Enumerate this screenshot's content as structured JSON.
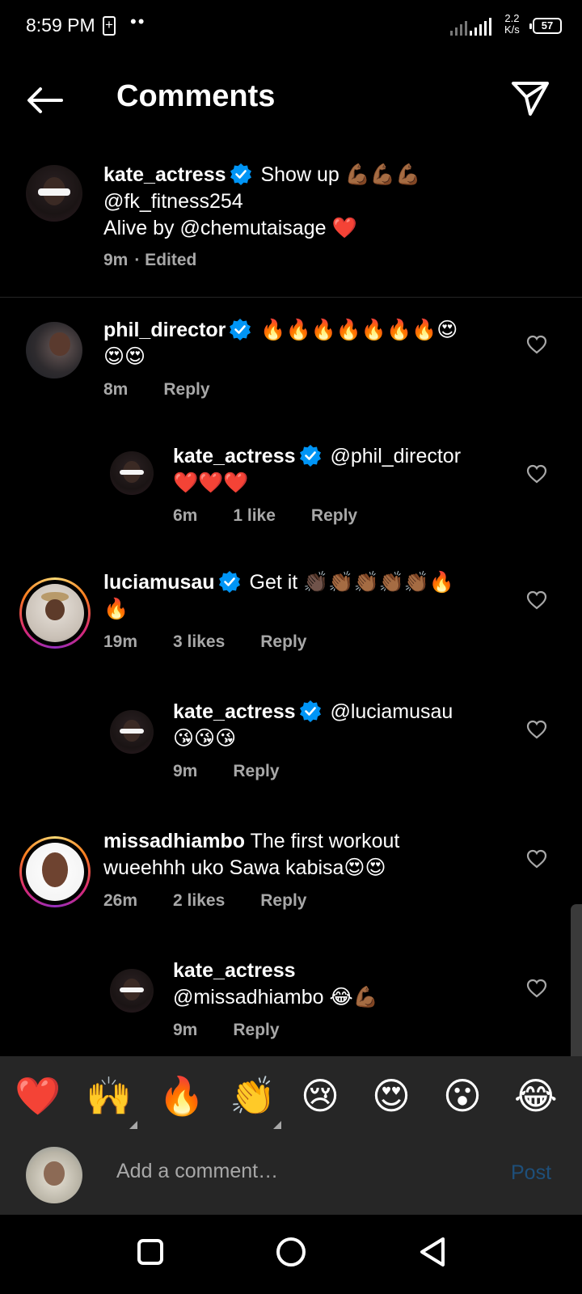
{
  "status_bar": {
    "time": "8:59 PM",
    "dots": "••",
    "speed_value": "2.2",
    "speed_unit": "K/s",
    "battery": "57"
  },
  "header": {
    "title": "Comments",
    "back_icon": "back-arrow-icon",
    "share_icon": "paper-plane-icon"
  },
  "caption": {
    "username": "kate_actress",
    "line1": "Show up 💪🏾💪🏾💪🏾",
    "line2": "@fk_fitness254",
    "line3": "Alive by @chemutaisage ❤️",
    "time": "9m",
    "edited": "· Edited"
  },
  "comments": [
    {
      "username": "phil_director",
      "text": "🔥🔥🔥🔥🔥🔥🔥😍",
      "text2": "😍😍",
      "time": "8m",
      "likes": "",
      "reply": "Reply"
    },
    {
      "username": "kate_actress",
      "text": "@phil_director",
      "text2": "❤️❤️❤️",
      "time": "6m",
      "likes": "1 like",
      "reply": "Reply"
    },
    {
      "username": "luciamusau",
      "text": "Get it 👏🏿👏🏾👏🏾👏🏾👏🏾🔥",
      "text2": "🔥",
      "time": "19m",
      "likes": "3 likes",
      "reply": "Reply"
    },
    {
      "username": "kate_actress",
      "text": "@luciamusau",
      "text2": "😘😘😘",
      "time": "9m",
      "likes": "",
      "reply": "Reply"
    },
    {
      "username": "missadhiambo",
      "text": "The first workout",
      "text2": "wueehhh uko Sawa kabisa😍😍",
      "time": "26m",
      "likes": "2 likes",
      "reply": "Reply"
    },
    {
      "username": "kate_actress",
      "text": "",
      "text2": "@missadhiambo 😂💪🏾",
      "time": "9m",
      "likes": "",
      "reply": "Reply"
    }
  ],
  "emoji_bar": [
    "❤️",
    "🙌",
    "🔥",
    "👏",
    "😢",
    "😍",
    "😮",
    "😂"
  ],
  "composer": {
    "placeholder": "Add a comment…",
    "post": "Post"
  },
  "colors": {
    "verified": "#0095f6",
    "secondary_text": "#a8a8a8",
    "post_disabled": "#1e4f7a",
    "bar_bg": "#262626"
  }
}
